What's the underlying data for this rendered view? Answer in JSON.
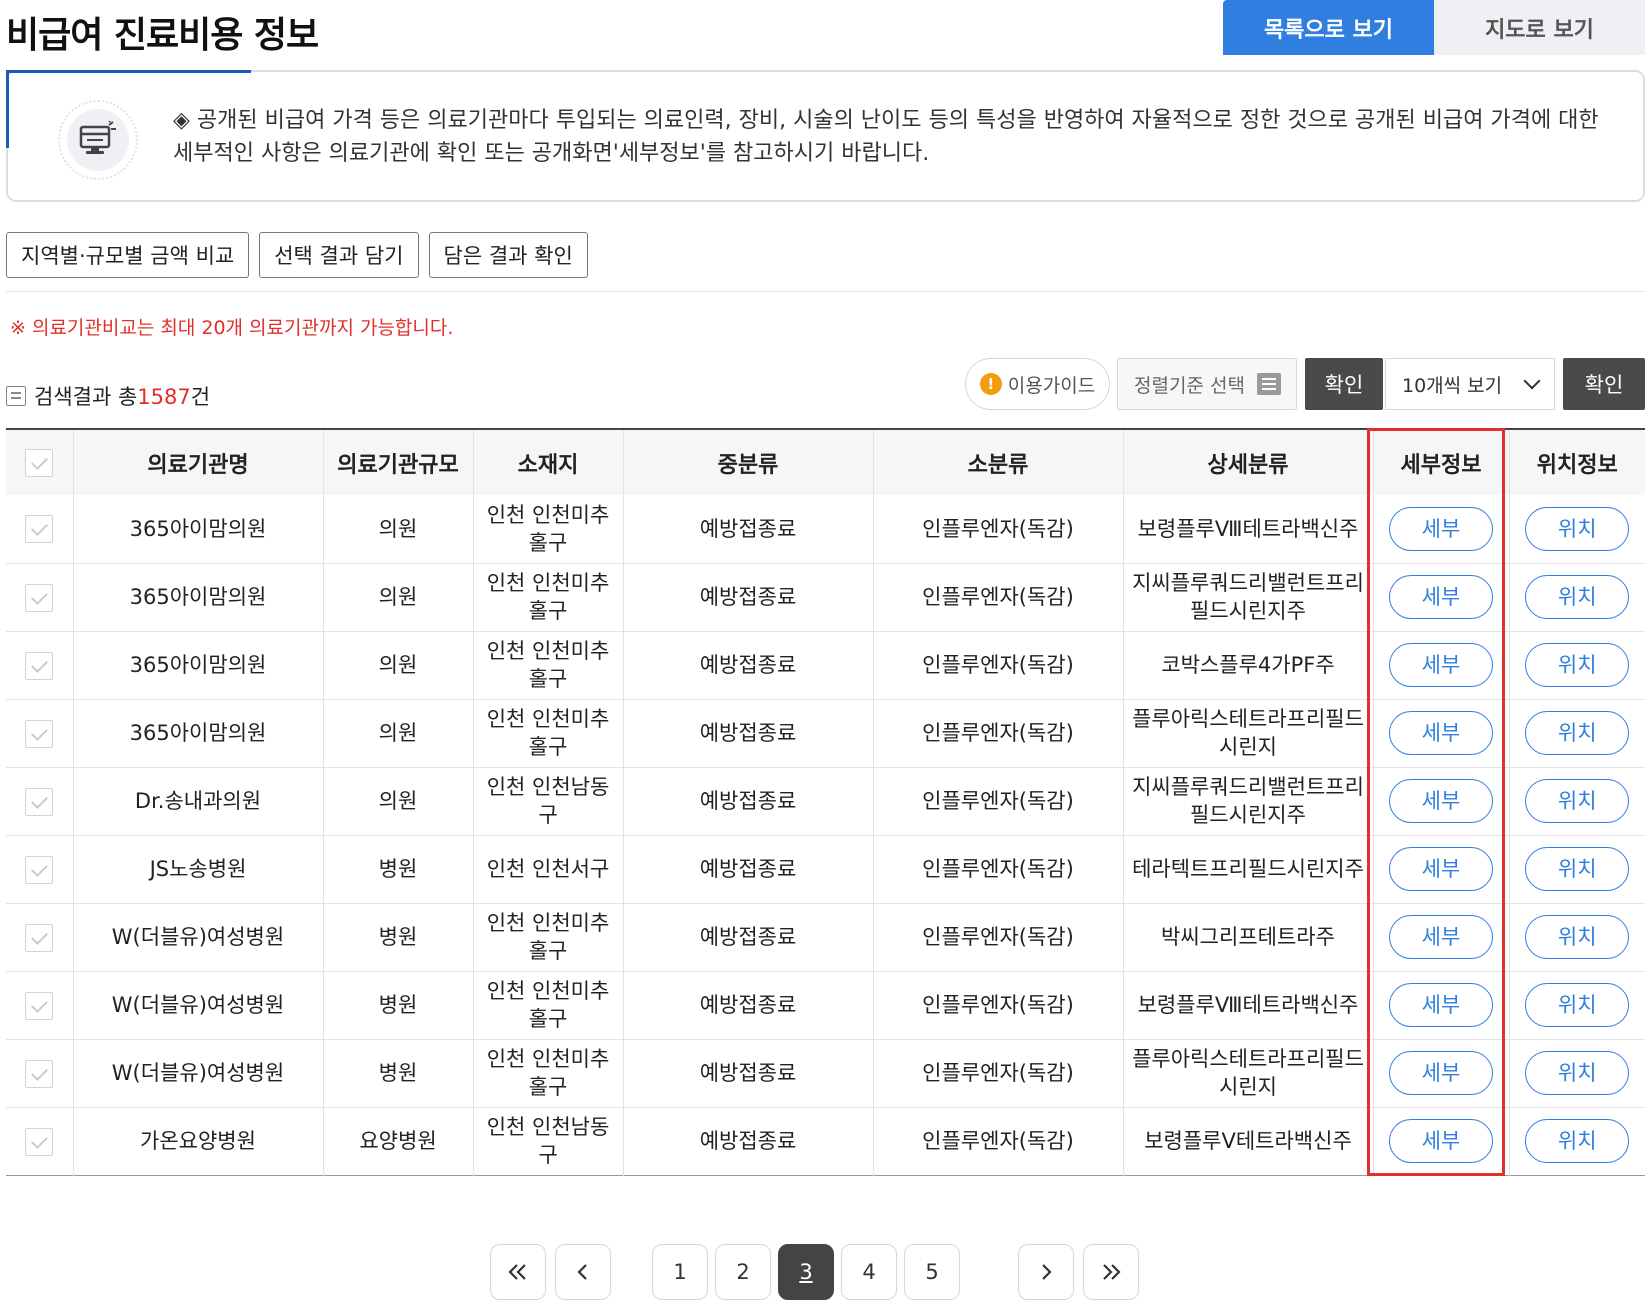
{
  "page": {
    "title": "비급여 진료비용 정보",
    "view_list_label": "목록으로 보기",
    "view_map_label": "지도로 보기"
  },
  "notice": {
    "text": "◈ 공개된 비급여 가격 등은 의료기관마다 투입되는 의료인력, 장비, 시술의 난이도 등의 특성을 반영하여 자율적으로 정한 것으로 공개된 비급여 가격에 대한 세부적인 사항은 의료기관에 확인 또는 공개화면'세부정보'를 참고하시기 바랍니다."
  },
  "actions": {
    "compare_label": "지역별·규모별 금액 비교",
    "add_label": "선택 결과 담기",
    "view_cart_label": "담은 결과 확인"
  },
  "compare_note": "※ 의료기관비교는 최대 20개 의료기관까지 가능합니다.",
  "results": {
    "prefix": "검색결과 총",
    "count": "1587",
    "suffix": "건"
  },
  "controls": {
    "guide_label": "이용가이드",
    "guide_icon": "!",
    "sort_label": "정렬기준 선택",
    "confirm_label": "확인",
    "per_page_label": "10개씩 보기",
    "confirm2_label": "확인"
  },
  "table": {
    "headers": [
      "의료기관명",
      "의료기관규모",
      "소재지",
      "중분류",
      "소분류",
      "상세분류",
      "세부정보",
      "위치정보"
    ],
    "detail_label": "세부",
    "location_label": "위치",
    "rows": [
      {
        "name": "365아이맘의원",
        "size": "의원",
        "loc": "인천 인천미추홀구",
        "mid": "예방접종료",
        "small": "인플루엔자(독감)",
        "detail": "보령플루Ⅷ테트라백신주"
      },
      {
        "name": "365아이맘의원",
        "size": "의원",
        "loc": "인천 인천미추홀구",
        "mid": "예방접종료",
        "small": "인플루엔자(독감)",
        "detail": "지씨플루쿼드리밸런트프리필드시린지주"
      },
      {
        "name": "365아이맘의원",
        "size": "의원",
        "loc": "인천 인천미추홀구",
        "mid": "예방접종료",
        "small": "인플루엔자(독감)",
        "detail": "코박스플루4가PF주"
      },
      {
        "name": "365아이맘의원",
        "size": "의원",
        "loc": "인천 인천미추홀구",
        "mid": "예방접종료",
        "small": "인플루엔자(독감)",
        "detail": "플루아릭스테트라프리필드시린지"
      },
      {
        "name": "Dr.송내과의원",
        "size": "의원",
        "loc": "인천 인천남동구",
        "mid": "예방접종료",
        "small": "인플루엔자(독감)",
        "detail": "지씨플루쿼드리밸런트프리필드시린지주"
      },
      {
        "name": "JS노송병원",
        "size": "병원",
        "loc": "인천 인천서구",
        "mid": "예방접종료",
        "small": "인플루엔자(독감)",
        "detail": "테라텍트프리필드시린지주"
      },
      {
        "name": "W(더블유)여성병원",
        "size": "병원",
        "loc": "인천 인천미추홀구",
        "mid": "예방접종료",
        "small": "인플루엔자(독감)",
        "detail": "박씨그리프테트라주"
      },
      {
        "name": "W(더블유)여성병원",
        "size": "병원",
        "loc": "인천 인천미추홀구",
        "mid": "예방접종료",
        "small": "인플루엔자(독감)",
        "detail": "보령플루Ⅷ테트라백신주"
      },
      {
        "name": "W(더블유)여성병원",
        "size": "병원",
        "loc": "인천 인천미추홀구",
        "mid": "예방접종료",
        "small": "인플루엔자(독감)",
        "detail": "플루아릭스테트라프리필드시린지"
      },
      {
        "name": "가온요양병원",
        "size": "요양병원",
        "loc": "인천 인천남동구",
        "mid": "예방접종료",
        "small": "인플루엔자(독감)",
        "detail": "보령플루Ⅴ테트라백신주"
      }
    ]
  },
  "pagination": {
    "pages": [
      "1",
      "2",
      "3",
      "4",
      "5"
    ],
    "current": "3"
  },
  "colors": {
    "accent": "#2f7ee0",
    "highlight_box": "#e0302b",
    "note": "#e0302b"
  },
  "icons": {
    "notice": "computer-monitor-icon",
    "first": "double-chevron-left-icon",
    "prev": "chevron-left-icon",
    "next": "chevron-right-icon",
    "last": "double-chevron-right-icon"
  }
}
